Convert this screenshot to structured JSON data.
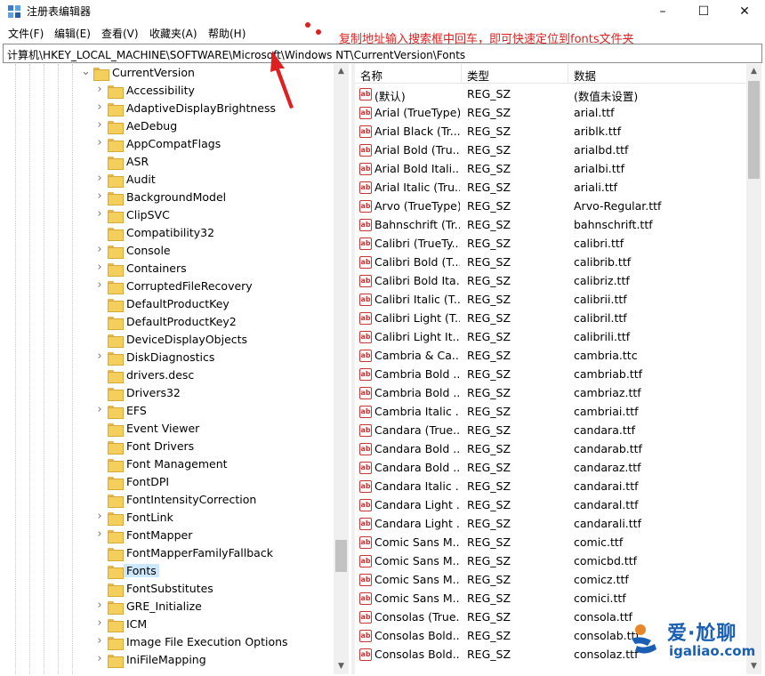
{
  "window": {
    "title": "注册表编辑器",
    "controls": [
      "–",
      "☐",
      "✕"
    ]
  },
  "menu": [
    "文件(F)",
    "编辑(E)",
    "查看(V)",
    "收藏夹(A)",
    "帮助(H)"
  ],
  "annotation": "复制地址输入搜索框中回车，即可快速定位到fonts文件夹",
  "address": "计算机\\HKEY_LOCAL_MACHINE\\SOFTWARE\\Microsoft\\Windows NT\\CurrentVersion\\Fonts",
  "tree": {
    "parent": "CurrentVersion",
    "children": [
      {
        "label": "Accessibility",
        "expandable": true
      },
      {
        "label": "AdaptiveDisplayBrightness",
        "expandable": true
      },
      {
        "label": "AeDebug",
        "expandable": true
      },
      {
        "label": "AppCompatFlags",
        "expandable": true
      },
      {
        "label": "ASR",
        "expandable": false
      },
      {
        "label": "Audit",
        "expandable": true
      },
      {
        "label": "BackgroundModel",
        "expandable": true
      },
      {
        "label": "ClipSVC",
        "expandable": true
      },
      {
        "label": "Compatibility32",
        "expandable": false
      },
      {
        "label": "Console",
        "expandable": true
      },
      {
        "label": "Containers",
        "expandable": true
      },
      {
        "label": "CorruptedFileRecovery",
        "expandable": true
      },
      {
        "label": "DefaultProductKey",
        "expandable": false
      },
      {
        "label": "DefaultProductKey2",
        "expandable": false
      },
      {
        "label": "DeviceDisplayObjects",
        "expandable": false
      },
      {
        "label": "DiskDiagnostics",
        "expandable": true
      },
      {
        "label": "drivers.desc",
        "expandable": false
      },
      {
        "label": "Drivers32",
        "expandable": false
      },
      {
        "label": "EFS",
        "expandable": true
      },
      {
        "label": "Event Viewer",
        "expandable": false
      },
      {
        "label": "Font Drivers",
        "expandable": false
      },
      {
        "label": "Font Management",
        "expandable": false
      },
      {
        "label": "FontDPI",
        "expandable": false
      },
      {
        "label": "FontIntensityCorrection",
        "expandable": false
      },
      {
        "label": "FontLink",
        "expandable": true
      },
      {
        "label": "FontMapper",
        "expandable": true
      },
      {
        "label": "FontMapperFamilyFallback",
        "expandable": false
      },
      {
        "label": "Fonts",
        "expandable": false,
        "selected": true
      },
      {
        "label": "FontSubstitutes",
        "expandable": false
      },
      {
        "label": "GRE_Initialize",
        "expandable": true
      },
      {
        "label": "ICM",
        "expandable": true
      },
      {
        "label": "Image File Execution Options",
        "expandable": true
      },
      {
        "label": "IniFileMapping",
        "expandable": true
      }
    ]
  },
  "values": {
    "headers": {
      "name": "名称",
      "type": "类型",
      "data": "数据"
    },
    "rows": [
      {
        "name": "(默认)",
        "type": "REG_SZ",
        "data": "(数值未设置)"
      },
      {
        "name": "Arial (TrueType)",
        "type": "REG_SZ",
        "data": "arial.ttf"
      },
      {
        "name": "Arial Black (Tr...",
        "type": "REG_SZ",
        "data": "ariblk.ttf"
      },
      {
        "name": "Arial Bold (Tru...",
        "type": "REG_SZ",
        "data": "arialbd.ttf"
      },
      {
        "name": "Arial Bold Itali...",
        "type": "REG_SZ",
        "data": "arialbi.ttf"
      },
      {
        "name": "Arial Italic (Tru...",
        "type": "REG_SZ",
        "data": "ariali.ttf"
      },
      {
        "name": "Arvo (TrueType)",
        "type": "REG_SZ",
        "data": "Arvo-Regular.ttf"
      },
      {
        "name": "Bahnschrift (Tr...",
        "type": "REG_SZ",
        "data": "bahnschrift.ttf"
      },
      {
        "name": "Calibri (TrueTy...",
        "type": "REG_SZ",
        "data": "calibri.ttf"
      },
      {
        "name": "Calibri Bold (T...",
        "type": "REG_SZ",
        "data": "calibrib.ttf"
      },
      {
        "name": "Calibri Bold Ita...",
        "type": "REG_SZ",
        "data": "calibriz.ttf"
      },
      {
        "name": "Calibri Italic (T...",
        "type": "REG_SZ",
        "data": "calibrii.ttf"
      },
      {
        "name": "Calibri Light (T...",
        "type": "REG_SZ",
        "data": "calibril.ttf"
      },
      {
        "name": "Calibri Light It...",
        "type": "REG_SZ",
        "data": "calibrili.ttf"
      },
      {
        "name": "Cambria & Ca...",
        "type": "REG_SZ",
        "data": "cambria.ttc"
      },
      {
        "name": "Cambria Bold ...",
        "type": "REG_SZ",
        "data": "cambriab.ttf"
      },
      {
        "name": "Cambria Bold ...",
        "type": "REG_SZ",
        "data": "cambriaz.ttf"
      },
      {
        "name": "Cambria Italic ...",
        "type": "REG_SZ",
        "data": "cambriai.ttf"
      },
      {
        "name": "Candara (True...",
        "type": "REG_SZ",
        "data": "candara.ttf"
      },
      {
        "name": "Candara Bold ...",
        "type": "REG_SZ",
        "data": "candarab.ttf"
      },
      {
        "name": "Candara Bold ...",
        "type": "REG_SZ",
        "data": "candaraz.ttf"
      },
      {
        "name": "Candara Italic ...",
        "type": "REG_SZ",
        "data": "candarai.ttf"
      },
      {
        "name": "Candara Light ...",
        "type": "REG_SZ",
        "data": "candaral.ttf"
      },
      {
        "name": "Candara Light ...",
        "type": "REG_SZ",
        "data": "candarali.ttf"
      },
      {
        "name": "Comic Sans M...",
        "type": "REG_SZ",
        "data": "comic.ttf"
      },
      {
        "name": "Comic Sans M...",
        "type": "REG_SZ",
        "data": "comicbd.ttf"
      },
      {
        "name": "Comic Sans M...",
        "type": "REG_SZ",
        "data": "comicz.ttf"
      },
      {
        "name": "Comic Sans M...",
        "type": "REG_SZ",
        "data": "comici.ttf"
      },
      {
        "name": "Consolas (True...",
        "type": "REG_SZ",
        "data": "consola.ttf"
      },
      {
        "name": "Consolas Bold...",
        "type": "REG_SZ",
        "data": "consolab.ttf"
      },
      {
        "name": "Consolas Bold...",
        "type": "REG_SZ",
        "data": "consolaz.ttf"
      }
    ]
  },
  "watermark": {
    "top": "爱·尬聊",
    "bottom": "igaliao.com"
  },
  "colors": {
    "annotation": "#e02020",
    "selection": "#cce8ff",
    "watermark": "#1a5fb4",
    "folder": "#f4cf5c"
  }
}
